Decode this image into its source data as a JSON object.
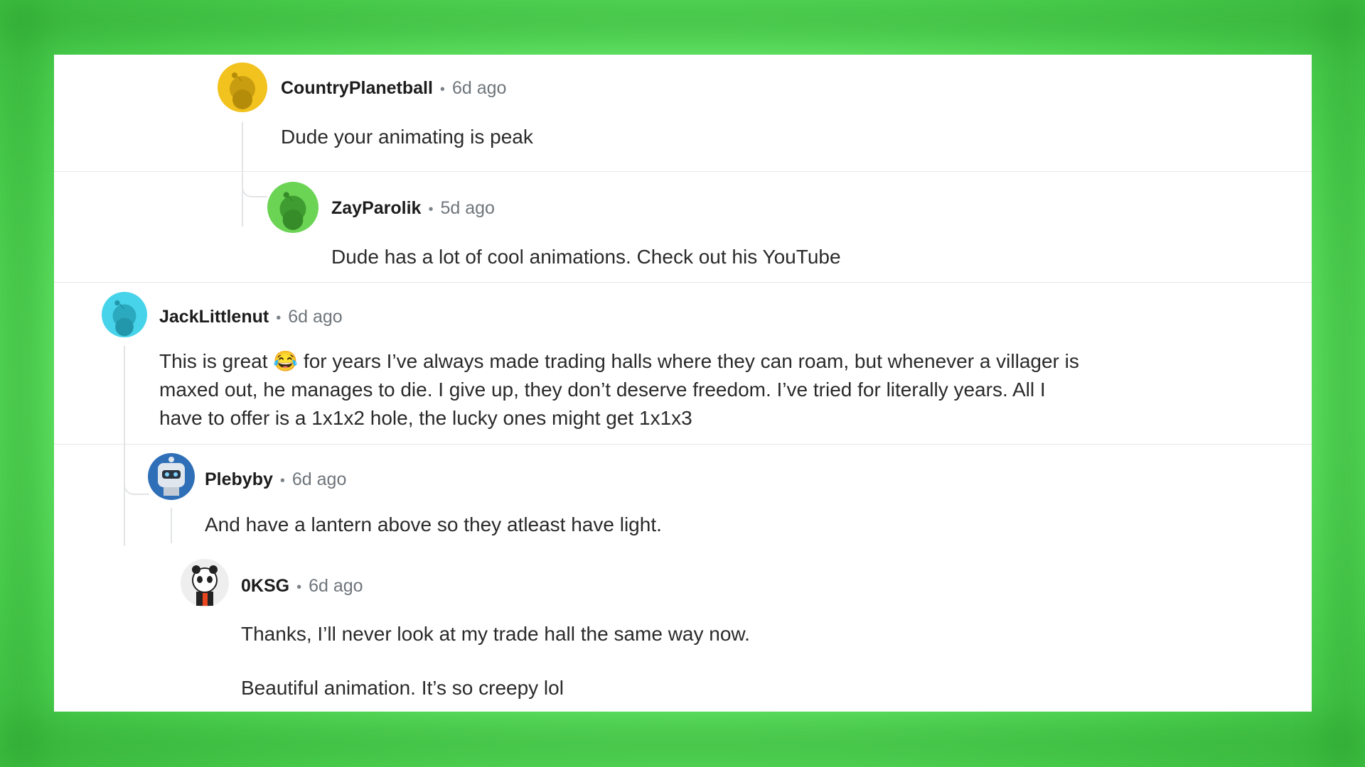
{
  "comments": [
    {
      "author": "CountryPlanetball",
      "time": "6d ago",
      "avatar_icon": "snoo-avatar-yellow",
      "avatar_color": "#f2c21e",
      "body": "Dude your animating is peak"
    },
    {
      "author": "ZayParolik",
      "time": "5d ago",
      "avatar_icon": "snoo-avatar-green",
      "avatar_color": "#6bd455",
      "body": "Dude has a lot of cool animations. Check out his YouTube"
    },
    {
      "author": "JackLittlenut",
      "time": "6d ago",
      "avatar_icon": "snoo-avatar-cyan",
      "avatar_color": "#47d3ea",
      "body_lines": [
        "This is great 😂 for years I’ve always made trading halls where they can roam, but whenever a villager is",
        "maxed out, he manages to die. I give up, they don’t deserve freedom. I’ve tried for literally years. All I",
        "have to offer is a 1x1x2 hole, the lucky ones might get 1x1x3"
      ]
    },
    {
      "author": "Plebyby",
      "time": "6d ago",
      "avatar_icon": "robot-avatar",
      "avatar_color": "#3a7fd0",
      "body": "And have a lantern above so they atleast have light."
    },
    {
      "author": "0KSG",
      "time": "6d ago",
      "avatar_icon": "panda-avatar",
      "avatar_color": "#e9e9e9",
      "body_lines": [
        "Thanks, I’ll never look at my trade hall the same way now.",
        "Beautiful animation. It’s so creepy lol"
      ]
    }
  ]
}
